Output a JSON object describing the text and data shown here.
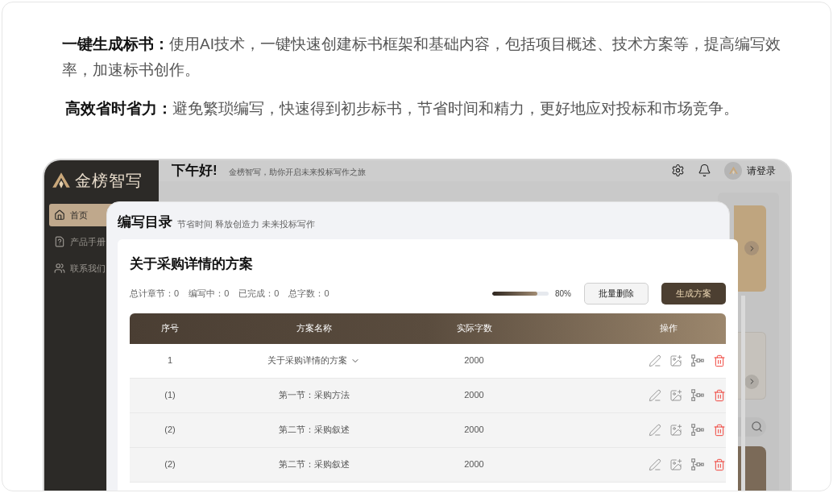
{
  "intro": [
    {
      "label": "一键生成标书：",
      "text": "使用AI技术，一键快速创建标书框架和基础内容，包括项目概述、技术方案等，提高编写效率，加速标书创作。"
    },
    {
      "label": "高效省时省力：",
      "text": "避免繁琐编写，快速得到初步标书，节省时间和精力，更好地应对投标和市场竞争。"
    }
  ],
  "app": {
    "logo": {
      "name": "金榜智写"
    },
    "header": {
      "greeting": "下午好!",
      "tagline": "金榜智写，助你开启未来投标写作之旅",
      "login": "请登录"
    },
    "sidebar": {
      "items": [
        {
          "label": "首页",
          "selected": true
        },
        {
          "label": "产品手册",
          "selected": false
        },
        {
          "label": "联系我们",
          "selected": false
        }
      ]
    },
    "modal": {
      "title": "编写目录",
      "subtitle": "节省时间 释放创造力 未来投标写作",
      "card": {
        "title": "关于采购详情的方案",
        "stats": [
          "总计章节：0",
          "编写中：0",
          "已完成：0",
          "总字数：0"
        ],
        "progress": {
          "level": 0.8,
          "reading": "80%"
        },
        "buttons": [
          {
            "label": "批量删除",
            "kind": "secondary"
          },
          {
            "label": "生成方案",
            "kind": "primary"
          }
        ],
        "table": {
          "columns": [
            "序号",
            "方案名称",
            "实际字数",
            "操作"
          ],
          "rows": [
            {
              "kind": "chapter",
              "index": "1",
              "name": "关于采购详情的方案",
              "words": "2000"
            },
            {
              "kind": "section",
              "index": "(1)",
              "name": "第一节：采购方法",
              "words": "2000"
            },
            {
              "kind": "section",
              "index": "(2)",
              "name": "第二节：采购叙述",
              "words": "2000"
            },
            {
              "kind": "section",
              "index": "(2)",
              "name": "第二节：采购叙述",
              "words": "2000"
            }
          ]
        }
      }
    }
  }
}
